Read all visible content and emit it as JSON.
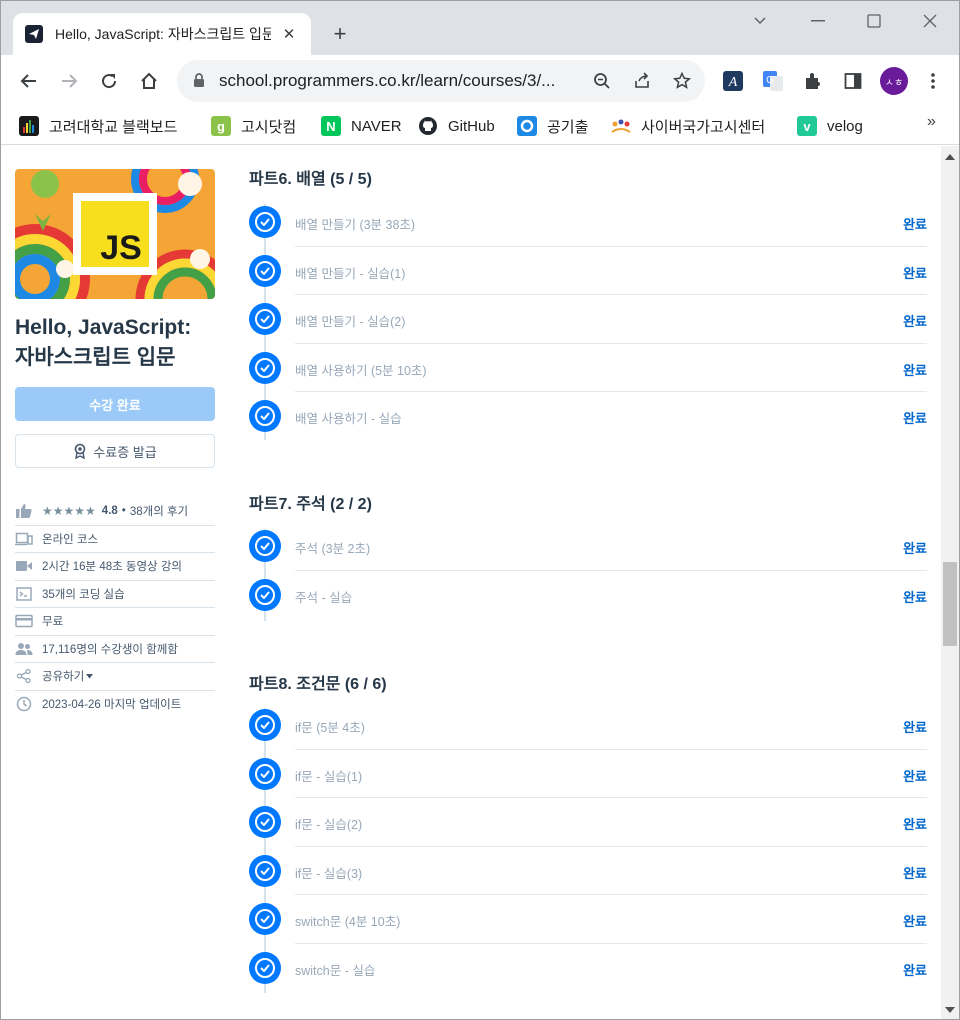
{
  "browser": {
    "tab_title": "Hello, JavaScript: 자바스크립트 입문",
    "tab_close": "✕",
    "newtab": "+",
    "url": "school.programmers.co.kr/learn/courses/3/...",
    "avatar_text": "ㅅㅎ",
    "bookmarks": [
      {
        "label": "고려대학교 블랙보드",
        "color": "#1a1a1a",
        "glyph": ""
      },
      {
        "label": "고시닷컴",
        "color": "#8bc34a",
        "glyph": "g"
      },
      {
        "label": "NAVER",
        "color": "#03c75a",
        "glyph": "N"
      },
      {
        "label": "GitHub",
        "color": "#24292f",
        "glyph": ""
      },
      {
        "label": "공기출",
        "color": "#1e88e5",
        "glyph": ""
      },
      {
        "label": "사이버국가고시센터",
        "color": "#f0a030",
        "glyph": ""
      },
      {
        "label": "velog",
        "color": "#20c997",
        "glyph": "v"
      }
    ],
    "bookmarks_more": "»"
  },
  "sidebar": {
    "thumb_text": "JS",
    "title_line1": "Hello, JavaScript:",
    "title_line2": "자바스크립트 입문",
    "done_button": "수강 완료",
    "cert_button": "수료증 발급",
    "rating_stars": "★★★★★",
    "rating_value": "4.8",
    "rating_sep": "•",
    "review_count": "38개의 후기",
    "meta": [
      {
        "icon": "laptop-icon",
        "text": "온라인 코스"
      },
      {
        "icon": "video-icon",
        "text": "2시간 16분 48초 동영상 강의"
      },
      {
        "icon": "terminal-icon",
        "text": "35개의 코딩 실습"
      },
      {
        "icon": "card-icon",
        "text": "무료"
      },
      {
        "icon": "users-icon",
        "text": "17,116명의 수강생이 함께함"
      },
      {
        "icon": "share-icon",
        "text": "공유하기"
      },
      {
        "icon": "clock-icon",
        "text": "2023-04-26 마지막 업데이트"
      }
    ]
  },
  "parts": [
    {
      "title": "파트6. 배열 (5 / 5)",
      "lessons": [
        {
          "name": "배열 만들기 (3분 38초)",
          "status": "완료"
        },
        {
          "name": "배열 만들기 - 실습(1)",
          "status": "완료"
        },
        {
          "name": "배열 만들기 - 실습(2)",
          "status": "완료"
        },
        {
          "name": "배열 사용하기 (5분 10초)",
          "status": "완료"
        },
        {
          "name": "배열 사용하기 - 실습",
          "status": "완료"
        }
      ]
    },
    {
      "title": "파트7. 주석 (2 / 2)",
      "lessons": [
        {
          "name": "주석 (3분 2초)",
          "status": "완료"
        },
        {
          "name": "주석 - 실습",
          "status": "완료"
        }
      ]
    },
    {
      "title": "파트8. 조건문 (6 / 6)",
      "lessons": [
        {
          "name": "if문 (5분 4초)",
          "status": "완료"
        },
        {
          "name": "if문 - 실습(1)",
          "status": "완료"
        },
        {
          "name": "if문 - 실습(2)",
          "status": "완료"
        },
        {
          "name": "if문 - 실습(3)",
          "status": "완료"
        },
        {
          "name": "switch문 (4분 10초)",
          "status": "완료"
        },
        {
          "name": "switch문 - 실습",
          "status": "완료"
        }
      ]
    }
  ],
  "colors": {
    "accent": "#0078ff",
    "status": "#0066cc",
    "title": "#263747",
    "muted": "#98a8b9"
  }
}
